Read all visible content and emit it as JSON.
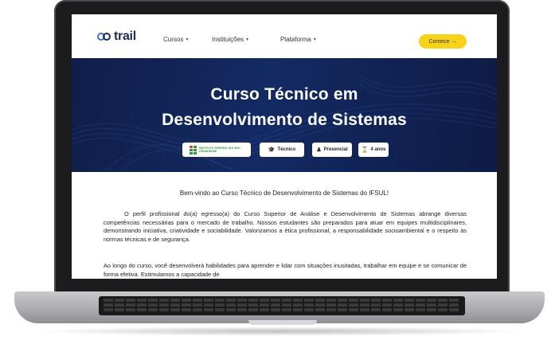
{
  "nav": {
    "logo_text": "trail",
    "items": [
      {
        "label": "Cursos"
      },
      {
        "label": "Instituições"
      },
      {
        "label": "Plataforma"
      }
    ],
    "cta_label": "Comece →"
  },
  "hero": {
    "title_line1": "Curso Técnico em",
    "title_line2": "Desenvolvimento de Sistemas",
    "badges": [
      {
        "label": "Técnico",
        "icon": "graduation-cap-icon"
      },
      {
        "label": "Presencial",
        "icon": "person-icon"
      },
      {
        "label": "4 anos",
        "icon": "hourglass-icon"
      }
    ],
    "institution_logo_text": "INSTITUTO FEDERAL SUL-RIO-GRANDENSE"
  },
  "content": {
    "welcome": "Bem-vindo ao Curso Técnico de Desenvolvimento de Sistemas do IFSUL!",
    "paragraph1": "O perfil profissional do(a) egresso(a) do Curso Superior de Análise e Desenvolvimento de Sistemas abrange diversas competências necessárias para o mercado de trabalho. Nossos estudantes são preparados para atuar em equipes multidisciplinares, demonstrando iniciativa, criatividade e sociabilidade. Valorizamos a ética profissional, a responsabilidade socioambiental e o respeito às normas técnicas e de segurança.",
    "paragraph2": "Ao longo do curso, você desenvolverá habilidades para aprender e lidar com situações inusitadas, trabalhar em equipe e se comunicar de forma efetiva. Estimulamos a capacidade de"
  },
  "colors": {
    "hero_bg": "#142a63",
    "cta_bg": "#f7d21a",
    "logo": "#1e2a52"
  }
}
